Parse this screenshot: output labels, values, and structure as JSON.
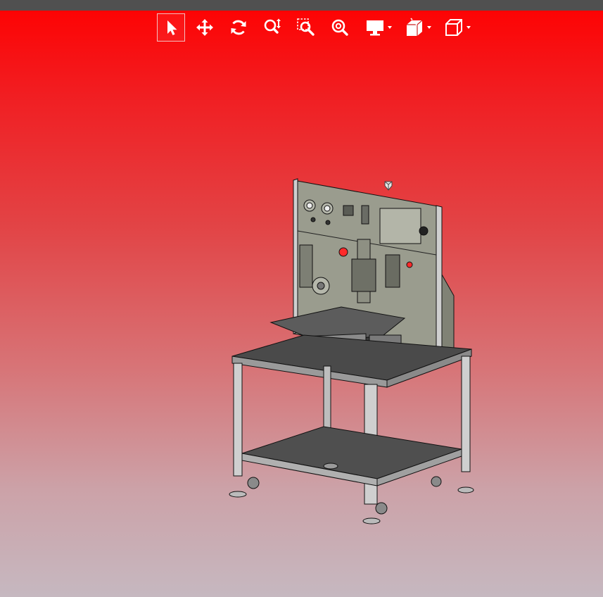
{
  "viewer": {
    "background_colors": [
      "#ff0000",
      "#e24446",
      "#c6b8c0"
    ],
    "topbar_color": "#505050",
    "model_colors": {
      "panel": "#9a9c8e",
      "table_top": "#4a4a4a",
      "frame": "#cfcfcf",
      "outline": "#111111"
    }
  },
  "toolbar": {
    "tools": [
      {
        "icon": "select-cursor-icon",
        "active": true
      },
      {
        "icon": "pan-arrows-icon",
        "active": false
      },
      {
        "icon": "rotate-icon",
        "active": false
      },
      {
        "icon": "zoom-icon",
        "active": false
      },
      {
        "icon": "zoom-window-icon",
        "active": false
      },
      {
        "icon": "zoom-fit-icon",
        "active": false
      },
      {
        "icon": "display-monitor-icon",
        "active": false,
        "dropdown": true
      },
      {
        "icon": "section-view-icon",
        "active": false,
        "dropdown": true
      },
      {
        "icon": "view-cube-icon",
        "active": false,
        "dropdown": true
      }
    ]
  }
}
